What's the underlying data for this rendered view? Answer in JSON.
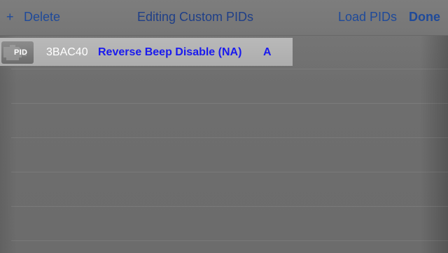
{
  "navbar": {
    "add_label": "+",
    "delete_label": "Delete",
    "title": "Editing Custom PIDs",
    "load_label": "Load PIDs",
    "done_label": "Done"
  },
  "pids": [
    {
      "icon_label": "PID",
      "code": "3BAC40",
      "name": "Reverse Beep Disable (NA)",
      "unit": "A"
    }
  ],
  "colors": {
    "nav_tint": "#1f4a9a",
    "pid_name": "#1a1aee",
    "background": "#6f6f6f"
  }
}
